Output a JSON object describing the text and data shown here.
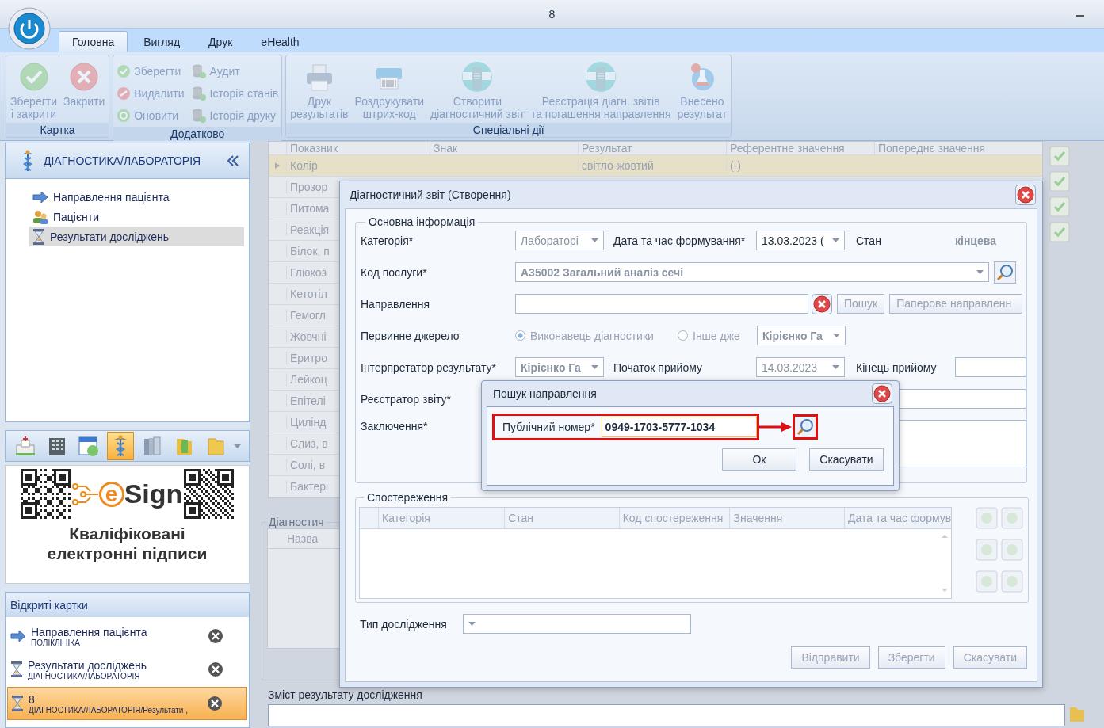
{
  "window": {
    "title": "8"
  },
  "ribbon": {
    "tabs": [
      {
        "label": "Головна",
        "selected": true
      },
      {
        "label": "Вигляд",
        "selected": false
      },
      {
        "label": "Друк",
        "selected": false
      },
      {
        "label": "eHealth",
        "selected": false
      }
    ],
    "groups": [
      {
        "title": "Картка",
        "kind": "large",
        "buttons": [
          {
            "lines": [
              "Зберегти",
              "і закрити"
            ],
            "disabled": true
          },
          {
            "lines": [
              "Закрити"
            ],
            "disabled": true
          }
        ]
      },
      {
        "title": "Додатково",
        "kind": "small",
        "buttons": [
          {
            "label": "Зберегти",
            "disabled": true
          },
          {
            "label": "Видалити",
            "disabled": true
          },
          {
            "label": "Оновити",
            "disabled": true
          },
          {
            "label": "Аудит",
            "disabled": true
          },
          {
            "label": "Історія станів",
            "disabled": true
          },
          {
            "label": "Історія друку",
            "disabled": true
          }
        ]
      },
      {
        "title": "Спеціальні дії",
        "kind": "large",
        "buttons": [
          {
            "lines": [
              "Друк",
              "результатів"
            ],
            "disabled": true
          },
          {
            "lines": [
              "Роздрукувати",
              "штрих-код"
            ],
            "disabled": true
          },
          {
            "lines": [
              "Створити",
              "діагностичний звіт"
            ],
            "disabled": true
          },
          {
            "lines": [
              "Реєстрація діагн. звітів",
              "та погашення направлення"
            ],
            "disabled": true
          },
          {
            "lines": [
              "Внесено",
              "результат"
            ],
            "disabled": true
          }
        ]
      }
    ]
  },
  "sidebar": {
    "title": "ДІАГНОСТИКА/ЛАБОРАТОРІЯ",
    "items": [
      {
        "label": "Направлення пацієнта",
        "selected": false
      },
      {
        "label": "Пацієнти",
        "selected": false
      },
      {
        "label": "Результати досліджень",
        "selected": true
      }
    ]
  },
  "module_bar": {
    "items": [
      {
        "selected": false
      },
      {
        "selected": false
      },
      {
        "selected": false
      },
      {
        "selected": true
      },
      {
        "selected": false
      },
      {
        "selected": false
      },
      {
        "selected": false
      }
    ]
  },
  "banner": {
    "logo_mark": "e",
    "logo_text": "Sign",
    "caption_lines": [
      "Кваліфіковані",
      "електронні підписи"
    ]
  },
  "open_cards": {
    "title": "Відкриті картки",
    "items": [
      {
        "title": "Направлення пацієнта",
        "subtitle": "ПОЛІКЛІНІКА",
        "selected": false
      },
      {
        "title": "Результати досліджень",
        "subtitle": "ДІАГНОСТИКА/ЛАБОРАТОРІЯ",
        "selected": false
      },
      {
        "title": "8",
        "subtitle": "ДІАГНОСТИКА/ЛАБОРАТОРІЯ/Результати ,",
        "selected": true
      }
    ]
  },
  "results_table": {
    "columns": [
      "Показник",
      "Знак",
      "Результат",
      "Референтне значення",
      "Попереднє значення"
    ],
    "rows": [
      {
        "indicator": "Колір",
        "result": "світло-жовтий",
        "reference": "(-)",
        "selected": true
      },
      {
        "indicator": "Прозор",
        "selected": false
      },
      {
        "indicator": "Питома",
        "selected": false
      },
      {
        "indicator": "Реакція",
        "selected": false
      },
      {
        "indicator": "Білок, п",
        "selected": false
      },
      {
        "indicator": "Глюкоз",
        "selected": false
      },
      {
        "indicator": "Кетотіл",
        "selected": false
      },
      {
        "indicator": "Гемогл",
        "selected": false
      },
      {
        "indicator": "Жовчні",
        "selected": false
      },
      {
        "indicator": "Еритро",
        "selected": false
      },
      {
        "indicator": "Лейкоц",
        "selected": false
      },
      {
        "indicator": "Епітелі",
        "selected": false
      },
      {
        "indicator": "Цилінд",
        "selected": false
      },
      {
        "indicator": "Слиз, в",
        "selected": false
      },
      {
        "indicator": "Солі, в",
        "selected": false
      },
      {
        "indicator": "Бактері",
        "selected": false
      }
    ]
  },
  "diagnostics_group": {
    "title": "Діагностич",
    "columns": [
      "Назва"
    ]
  },
  "content_field": {
    "label": "Зміст результату дослідження"
  },
  "dialog": {
    "title": "Діагностичний звіт (Створення)",
    "main_info": {
      "title": "Основна інформація",
      "category_label": "Категорія*",
      "category_value": "Лабораторі",
      "date_label": "Дата та час формування*",
      "date_value": "13.03.2023 (",
      "state_label": "Стан",
      "state_value": "кінцева",
      "service_label": "Код послуги*",
      "service_value": "A35002 Загальний аналіз сечі",
      "referral_label": "Направлення",
      "search_button": "Пошук",
      "paper_button": "Паперове направленн",
      "source_label": "Первинне джерело",
      "source_options": [
        {
          "label": "Виконавець діагностики",
          "selected": true
        },
        {
          "label": "Інше дже",
          "selected": false
        }
      ],
      "source_value": "Кірієнко Га",
      "interpreter_label": "Інтерпретатор результату*",
      "interpreter_value": "Кірієнко Га",
      "start_label": "Початок прийому",
      "start_value": "14.03.2023",
      "end_label": "Кінець прийому",
      "registrar_label": "Реєстратор звіту*",
      "conclusion_label": "Заключення*"
    },
    "observations": {
      "title": "Спостереження",
      "columns": [
        "Категорія",
        "Стан",
        "Код спостереження",
        "Значення",
        "Дата та час формув"
      ]
    },
    "study_type": {
      "label": "Тип дослідження"
    },
    "buttons": [
      {
        "label": "Відправити",
        "disabled": true
      },
      {
        "label": "Зберегти",
        "disabled": true
      },
      {
        "label": "Скасувати",
        "disabled": true
      }
    ]
  },
  "search_dialog": {
    "title": "Пошук направлення",
    "label": "Публічний номер*",
    "value": "0949-1703-5777-1034",
    "buttons": [
      {
        "label": "Ок",
        "disabled": false
      },
      {
        "label": "Скасувати",
        "disabled": false
      }
    ]
  }
}
